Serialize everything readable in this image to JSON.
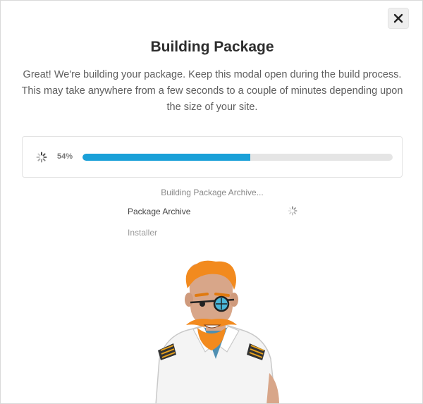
{
  "modal": {
    "title": "Building Package",
    "description": "Great! We're building your package. Keep this modal open during the build process. This may take anywhere from a few seconds to a couple of minutes depending upon the size of your site.",
    "close_icon": "close-icon"
  },
  "progress": {
    "percent_label": "54%",
    "value": 0.54,
    "bar_color": "#1aa0d8",
    "track_color": "#e5e5e5",
    "spinner_icon": "spinner-icon"
  },
  "status": {
    "current": "Building Package Archive..."
  },
  "steps": [
    {
      "label": "Package Archive",
      "state": "in-progress",
      "icon": "spinner-icon"
    },
    {
      "label": "Installer",
      "state": "pending"
    }
  ],
  "mascot": {
    "icon": "pirate-mascot-icon",
    "hair_color": "#f28a1e",
    "eyepatch_color": "#4bb6d8"
  }
}
